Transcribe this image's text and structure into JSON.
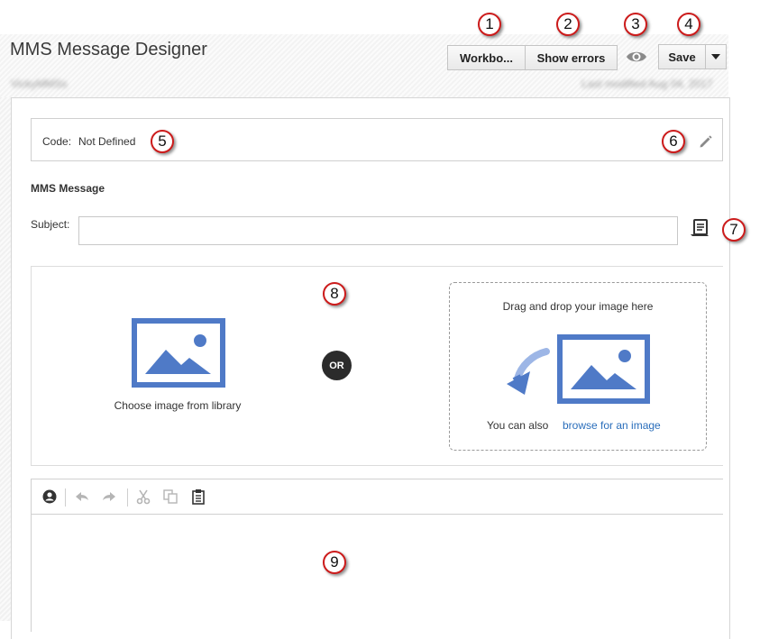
{
  "header": {
    "title": "MMS Message Designer",
    "user_blurred": "VickyMMSs",
    "modified_blurred": "Last modified Aug 04, 2017"
  },
  "toolbar": {
    "workbook_label": "Workbo...",
    "show_errors_label": "Show errors",
    "save_label": "Save",
    "save_dropdown_icon": "caret-down-icon",
    "preview_icon": "eye-icon"
  },
  "code": {
    "label": "Code:",
    "value": "Not Defined",
    "edit_icon": "pencil-icon"
  },
  "message": {
    "section_title": "MMS Message",
    "subject_label": "Subject:",
    "subject_value": "",
    "personalize_icon": "personalization-icon"
  },
  "image": {
    "library_label": "Choose image from library",
    "or_label": "OR",
    "drop_text": "Drag and drop your image here",
    "also_text": "You can also",
    "browse_link": "browse for an image"
  },
  "editor_toolbar": [
    "personalize-icon",
    "undo-icon",
    "redo-icon",
    "cut-icon",
    "copy-icon",
    "paste-icon"
  ],
  "callouts": [
    "1",
    "2",
    "3",
    "4",
    "5",
    "6",
    "7",
    "8",
    "9"
  ],
  "colors": {
    "image_icon": "#4f7ac7",
    "link": "#2a6ebb",
    "callout_border": "#cc1b1b",
    "or_badge": "#2b2b2b"
  }
}
